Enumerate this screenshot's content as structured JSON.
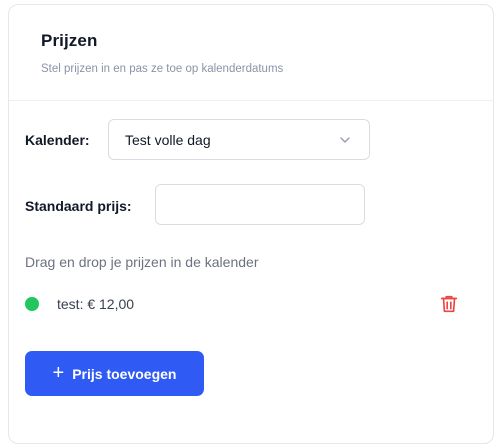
{
  "header": {
    "title": "Prijzen",
    "subtitle": "Stel prijzen in en pas ze toe op kalenderdatums"
  },
  "form": {
    "calendar_label": "Kalender:",
    "calendar_value": "Test volle dag",
    "default_price_label": "Standaard prijs:",
    "default_price_value": ""
  },
  "hint": "Drag en drop je prijzen in de kalender",
  "prices": [
    {
      "label": "test: € 12,00",
      "color": "#22c55e"
    }
  ],
  "actions": {
    "add_price_label": "Prijs toevoegen",
    "add_icon": "plus-icon"
  },
  "colors": {
    "accent": "#2f5bf4",
    "danger": "#ef4444"
  }
}
